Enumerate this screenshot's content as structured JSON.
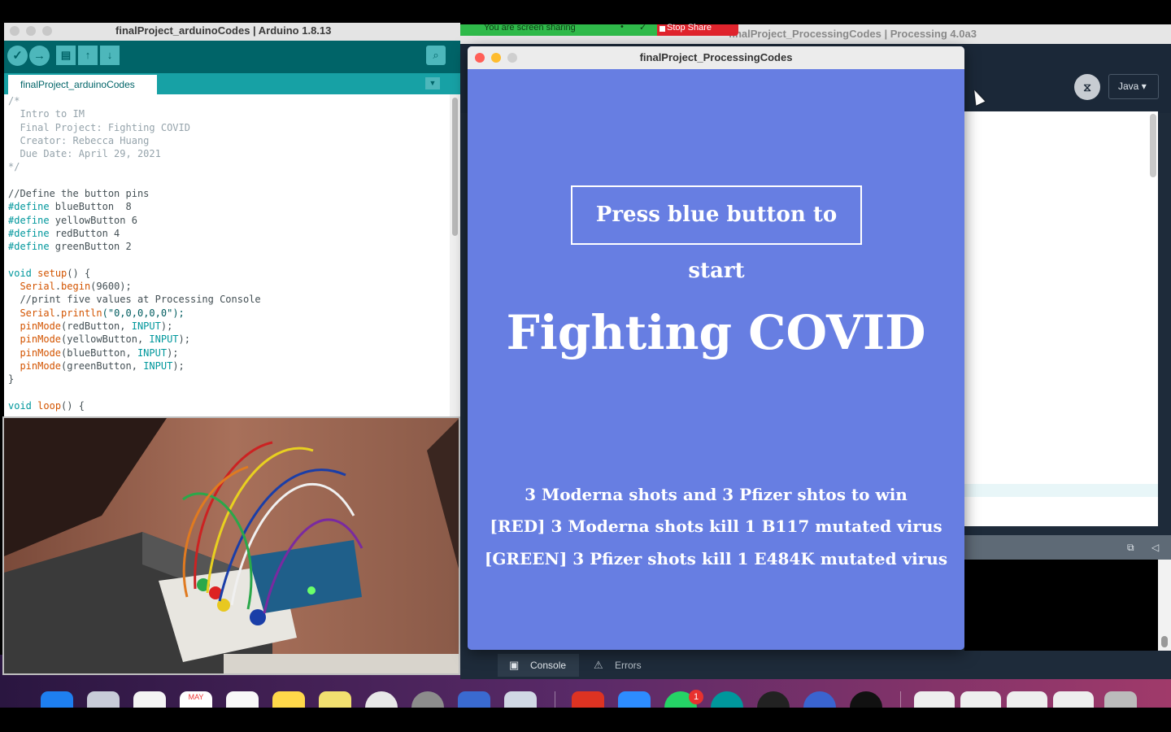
{
  "zoom": {
    "sharing_text": "You are screen sharing",
    "stop_share_label": "Stop Share"
  },
  "arduino": {
    "window_title": "finalProject_arduinoCodes | Arduino 1.8.13",
    "tab_label": "finalProject_arduinoCodes",
    "code_lines": [
      {
        "parts": [
          {
            "c": "com",
            "t": "/*"
          }
        ]
      },
      {
        "parts": [
          {
            "c": "com",
            "t": "  Intro to IM"
          }
        ]
      },
      {
        "parts": [
          {
            "c": "com",
            "t": "  Final Project: Fighting COVID"
          }
        ]
      },
      {
        "parts": [
          {
            "c": "com",
            "t": "  Creator: Rebecca Huang"
          }
        ]
      },
      {
        "parts": [
          {
            "c": "com",
            "t": "  Due Date: April 29, 2021"
          }
        ]
      },
      {
        "parts": [
          {
            "c": "com",
            "t": "*/"
          }
        ]
      },
      {
        "parts": [
          {
            "c": "pl",
            "t": ""
          }
        ]
      },
      {
        "parts": [
          {
            "c": "pl",
            "t": "//Define the button pins"
          }
        ]
      },
      {
        "parts": [
          {
            "c": "kw",
            "t": "#define"
          },
          {
            "c": "pl",
            "t": " blueButton  8"
          }
        ]
      },
      {
        "parts": [
          {
            "c": "kw",
            "t": "#define"
          },
          {
            "c": "pl",
            "t": " yellowButton 6"
          }
        ]
      },
      {
        "parts": [
          {
            "c": "kw",
            "t": "#define"
          },
          {
            "c": "pl",
            "t": " redButton 4"
          }
        ]
      },
      {
        "parts": [
          {
            "c": "kw",
            "t": "#define"
          },
          {
            "c": "pl",
            "t": " greenButton 2"
          }
        ]
      },
      {
        "parts": [
          {
            "c": "pl",
            "t": ""
          }
        ]
      },
      {
        "parts": [
          {
            "c": "kw",
            "t": "void"
          },
          {
            "c": "pl",
            "t": " "
          },
          {
            "c": "fn",
            "t": "setup"
          },
          {
            "c": "pl",
            "t": "() {"
          }
        ]
      },
      {
        "parts": [
          {
            "c": "pl",
            "t": "  "
          },
          {
            "c": "fn",
            "t": "Serial"
          },
          {
            "c": "pl",
            "t": "."
          },
          {
            "c": "fn",
            "t": "begin"
          },
          {
            "c": "pl",
            "t": "(9600);"
          }
        ]
      },
      {
        "parts": [
          {
            "c": "pl",
            "t": "  //print five values at Processing Console"
          }
        ]
      },
      {
        "parts": [
          {
            "c": "pl",
            "t": "  "
          },
          {
            "c": "fn",
            "t": "Serial"
          },
          {
            "c": "pl",
            "t": "."
          },
          {
            "c": "fn",
            "t": "println"
          },
          {
            "c": "str",
            "t": "(\"0,0,0,0,0\");"
          }
        ]
      },
      {
        "parts": [
          {
            "c": "pl",
            "t": "  "
          },
          {
            "c": "fn",
            "t": "pinMode"
          },
          {
            "c": "pl",
            "t": "(redButton, "
          },
          {
            "c": "kw",
            "t": "INPUT"
          },
          {
            "c": "pl",
            "t": ");"
          }
        ]
      },
      {
        "parts": [
          {
            "c": "pl",
            "t": "  "
          },
          {
            "c": "fn",
            "t": "pinMode"
          },
          {
            "c": "pl",
            "t": "(yellowButton, "
          },
          {
            "c": "kw",
            "t": "INPUT"
          },
          {
            "c": "pl",
            "t": ");"
          }
        ]
      },
      {
        "parts": [
          {
            "c": "pl",
            "t": "  "
          },
          {
            "c": "fn",
            "t": "pinMode"
          },
          {
            "c": "pl",
            "t": "(blueButton, "
          },
          {
            "c": "kw",
            "t": "INPUT"
          },
          {
            "c": "pl",
            "t": ");"
          }
        ]
      },
      {
        "parts": [
          {
            "c": "pl",
            "t": "  "
          },
          {
            "c": "fn",
            "t": "pinMode"
          },
          {
            "c": "pl",
            "t": "(greenButton, "
          },
          {
            "c": "kw",
            "t": "INPUT"
          },
          {
            "c": "pl",
            "t": ");"
          }
        ]
      },
      {
        "parts": [
          {
            "c": "pl",
            "t": "}"
          }
        ]
      },
      {
        "parts": [
          {
            "c": "pl",
            "t": ""
          }
        ]
      },
      {
        "parts": [
          {
            "c": "kw",
            "t": "void"
          },
          {
            "c": "pl",
            "t": " "
          },
          {
            "c": "fn",
            "t": "loop"
          },
          {
            "c": "pl",
            "t": "() {"
          }
        ]
      }
    ]
  },
  "processing": {
    "window_title": "finalProject_ProcessingCodes | Processing 4.0a3",
    "mode_label": "Java",
    "console_tab": "Console",
    "errors_tab": "Errors"
  },
  "sketch": {
    "window_title": "finalProject_ProcessingCodes",
    "start_button": "Press blue button to start",
    "title": "Fighting COVID",
    "rules": [
      "3 Moderna shots and 3 Pfizer shtos to win",
      "[RED] 3 Moderna shots kill 1 B117 mutated virus",
      "[GREEN] 3 Pfizer shots kill 1 E484K mutated virus"
    ],
    "background_color": "#677ee2"
  },
  "dock": {
    "calendar_month": "MAY",
    "whatsapp_badge": "1"
  }
}
